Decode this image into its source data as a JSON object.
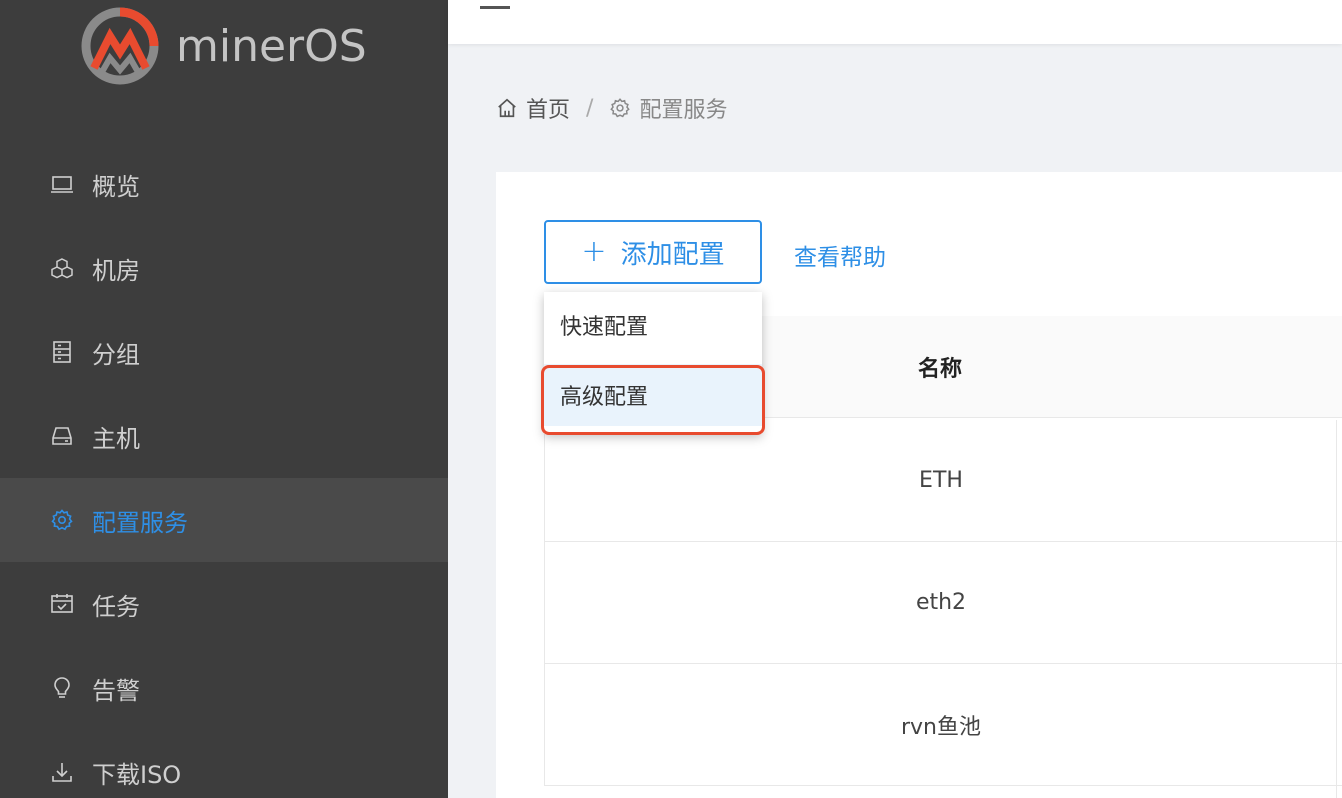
{
  "app": {
    "brand": "minerOS",
    "brand_color": "#e84b2f",
    "accent": "#2e8fe6"
  },
  "sidebar": {
    "items": [
      {
        "label": "概览",
        "icon": "laptop-icon"
      },
      {
        "label": "机房",
        "icon": "cubes-icon"
      },
      {
        "label": "分组",
        "icon": "server-icon"
      },
      {
        "label": "主机",
        "icon": "drive-icon"
      },
      {
        "label": "配置服务",
        "icon": "gear-icon",
        "active": true
      },
      {
        "label": "任务",
        "icon": "calendar-check-icon"
      },
      {
        "label": "告警",
        "icon": "bulb-icon"
      },
      {
        "label": "下载ISO",
        "icon": "download-icon"
      }
    ]
  },
  "header": {
    "menu_icon": "hamburger-icon"
  },
  "breadcrumb": {
    "home": "首页",
    "separator": "/",
    "current": "配置服务"
  },
  "toolbar": {
    "add_label": "添加配置",
    "add_icon": "+",
    "help_label": "查看帮助"
  },
  "dropdown": {
    "items": [
      "快速配置",
      "高级配置"
    ],
    "highlighted_index": 1
  },
  "table": {
    "columns": [
      "名称"
    ],
    "rows": [
      "ETH",
      "eth2",
      "rvn鱼池"
    ]
  }
}
